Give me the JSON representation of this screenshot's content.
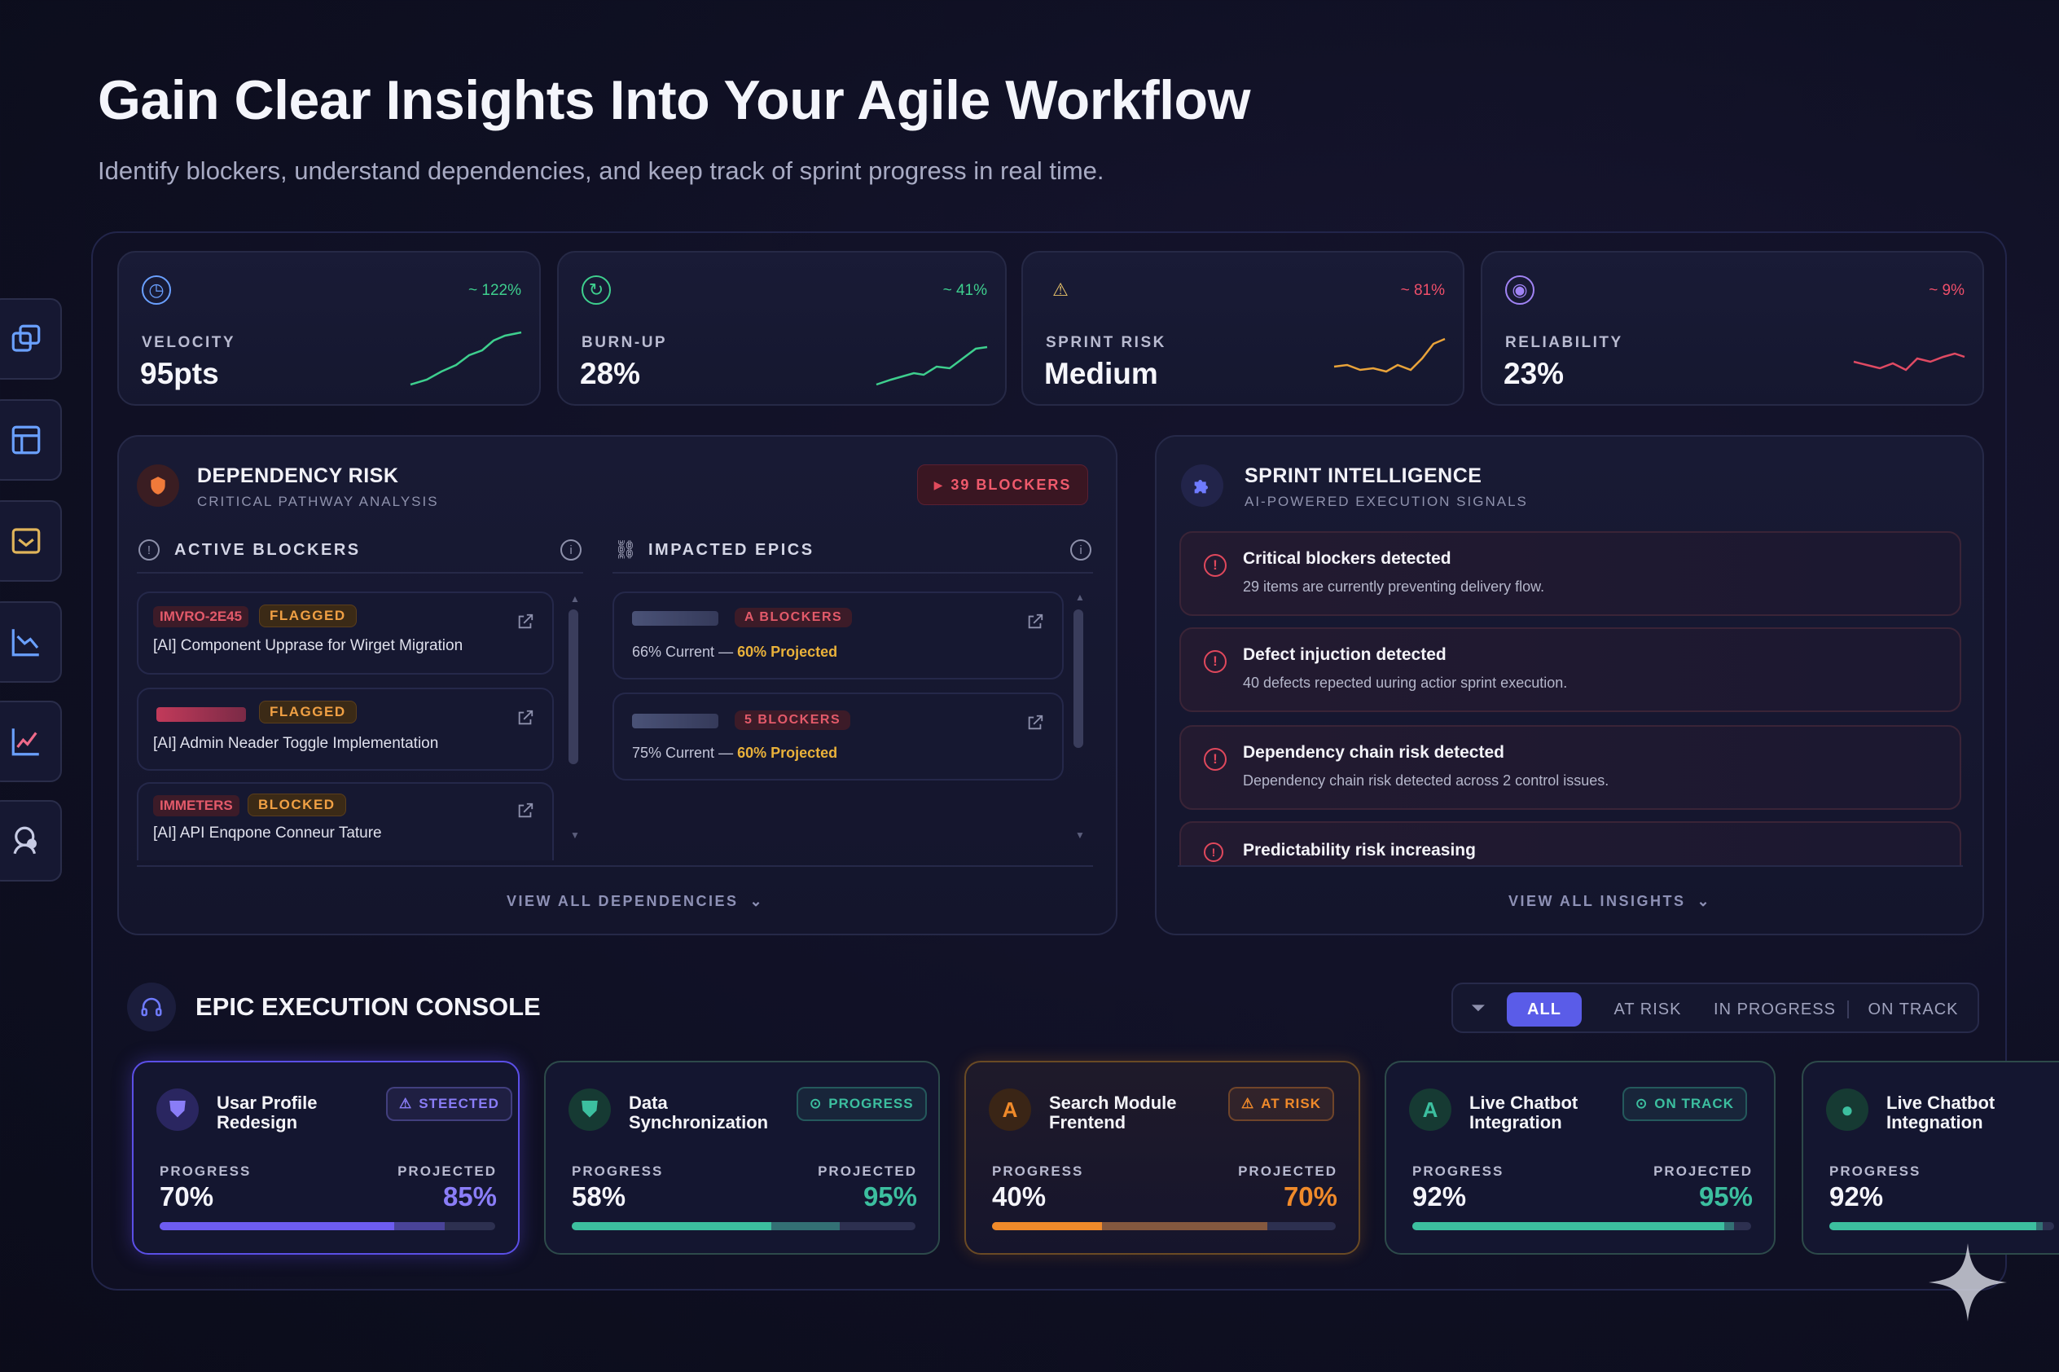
{
  "header": {
    "title": "Gain Clear Insights Into Your Agile Workflow",
    "subtitle": "Identify blockers, understand dependencies, and keep track of sprint progress in real time."
  },
  "sidebar": {
    "icons": [
      "dashboard-icon",
      "board-icon",
      "inbox-icon",
      "chart-icon",
      "analytics-icon",
      "team-icon"
    ]
  },
  "metrics": [
    {
      "label": "VELOCITY",
      "value": "95pts",
      "delta": "~ 122%",
      "color": "#3ecf8e",
      "icon": "gauge-icon"
    },
    {
      "label": "BURN-UP",
      "value": "28%",
      "delta": "~ 41%",
      "color": "#3ecf8e",
      "icon": "refresh-icon"
    },
    {
      "label": "SPRINT RISK",
      "value": "Medium",
      "delta": "~ 81%",
      "color": "#e9a33a",
      "delta_color": "#ef4f6a",
      "icon": "warning-icon"
    },
    {
      "label": "RELIABILITY",
      "value": "23%",
      "delta": "~ 9%",
      "color": "#e04a63",
      "icon": "target-icon"
    }
  ],
  "dependency": {
    "title": "DEPENDENCY RISK",
    "subtitle": "CRITICAL PATHWAY ANALYSIS",
    "blockers_badge": "39 BLOCKERS",
    "active_blockers_label": "ACTIVE BLOCKERS",
    "impacted_epics_label": "IMPACTED EPICS",
    "blockers": [
      {
        "code": "IMVRO-2E45",
        "tag": "FLAGGED",
        "text": "[AI] Component Upprase for Wirget Migration"
      },
      {
        "code": "",
        "tag": "FLAGGED",
        "text": "[AI] Admin Neader Toggle Implementation"
      },
      {
        "code": "IMMETERS",
        "tag": "BLOCKED",
        "text": "[AI] API Enqpone Conneur Tature"
      }
    ],
    "epics": [
      {
        "badge": "A BLOCKERS",
        "current": "66% Current",
        "sep": " — ",
        "projected": "60% Projected"
      },
      {
        "badge": "5 BLOCKERS",
        "current": "75% Current",
        "sep": " — ",
        "projected": "60% Projected"
      }
    ],
    "view_all": "VIEW ALL DEPENDENCIES"
  },
  "intelligence": {
    "title": "SPRINT INTELLIGENCE",
    "subtitle": "AI-POWERED EXECUTION SIGNALS",
    "items": [
      {
        "title": "Critical blockers detected",
        "desc": "29 items are currently preventing delivery flow."
      },
      {
        "title": "Defect injuction detected",
        "desc": "40 defects repected uuring actior sprint execution."
      },
      {
        "title": "Dependency chain risk detected",
        "desc": "Dependency chain risk detected across 2 control issues."
      },
      {
        "title": "Predictability risk increasing",
        "desc": ""
      }
    ],
    "view_all": "VIEW ALL INSIGHTS"
  },
  "console": {
    "title": "EPIC EXECUTION CONSOLE",
    "filters": [
      "ALL",
      "AT RISK",
      "IN PROGRESS",
      "ON TRACK"
    ],
    "active_filter": "ALL",
    "progress_label": "PROGRESS",
    "projected_label": "PROJECTED",
    "epics": [
      {
        "name1": "Usar Profile",
        "name2": "Redesign",
        "badge": "STEECTED",
        "progress": "70%",
        "projected": "85%",
        "progress_value": 0.7,
        "projected_value": 0.85,
        "color": "#6d5cf0",
        "accent": "#8a7df7",
        "icon": "shield-icon",
        "icon_glyph": "⛊"
      },
      {
        "name1": "Data",
        "name2": "Synchronization",
        "badge": "PROGRESS",
        "progress": "58%",
        "projected": "95%",
        "progress_value": 0.58,
        "projected_value": 0.78,
        "color": "#3cbf9f",
        "accent": "#3cbf9f",
        "icon": "shield-icon",
        "icon_glyph": "⛊"
      },
      {
        "name1": "Search Module",
        "name2": "Frentend",
        "badge": "AT RISK",
        "progress": "40%",
        "projected": "70%",
        "progress_value": 0.32,
        "projected_value": 0.8,
        "color": "#f08a2a",
        "accent": "#f08a2a",
        "icon": "person-icon",
        "icon_glyph": "A"
      },
      {
        "name1": "Live Chatbot",
        "name2": "Integration",
        "badge": "ON TRACK",
        "progress": "92%",
        "projected": "95%",
        "progress_value": 0.92,
        "projected_value": 0.95,
        "color": "#3cbf9f",
        "accent": "#3cbf9f",
        "icon": "person-icon",
        "icon_glyph": "A"
      },
      {
        "name1": "Live Chatbot",
        "name2": "Integnation",
        "badge": "",
        "progress": "92%",
        "projected": "",
        "progress_value": 0.92,
        "projected_value": 0.95,
        "color": "#3cbf9f",
        "accent": "#3cbf9f",
        "icon": "chat-icon",
        "icon_glyph": "●"
      }
    ]
  }
}
